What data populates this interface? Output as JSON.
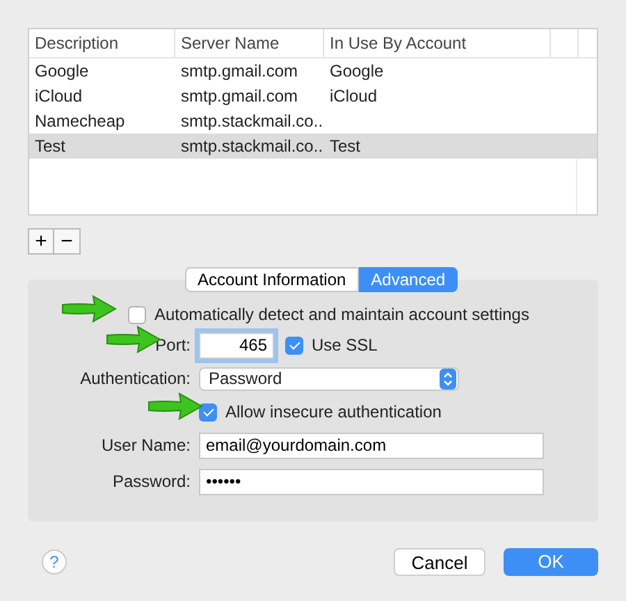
{
  "table": {
    "columns": [
      "Description",
      "Server Name",
      "In Use By Account"
    ],
    "rows": [
      {
        "cells": [
          "Google",
          "smtp.gmail.com",
          "Google"
        ],
        "selected": false
      },
      {
        "cells": [
          "iCloud",
          "smtp.gmail.com",
          "iCloud"
        ],
        "selected": false
      },
      {
        "cells": [
          "Namecheap",
          "smtp.stackmail.co..",
          ""
        ],
        "selected": false
      },
      {
        "cells": [
          "Test",
          "smtp.stackmail.co..",
          "Test"
        ],
        "selected": true
      }
    ]
  },
  "list_controls": {
    "add": "+",
    "remove": "−"
  },
  "tabs": [
    {
      "label": "Account Information",
      "selected": false
    },
    {
      "label": "Advanced",
      "selected": true
    }
  ],
  "settings": {
    "auto_detect": {
      "label": "Automatically detect and maintain account settings",
      "checked": false
    },
    "port": {
      "label": "Port:",
      "value": "465",
      "focused": true
    },
    "use_ssl": {
      "label": "Use SSL",
      "checked": true
    },
    "authentication": {
      "label": "Authentication:",
      "value": "Password"
    },
    "allow_insecure": {
      "label": "Allow insecure authentication",
      "checked": true
    },
    "user_name": {
      "label": "User Name:",
      "value": "email@yourdomain.com"
    },
    "password": {
      "label": "Password:",
      "value": "••••••"
    }
  },
  "buttons": {
    "help": "?",
    "cancel": "Cancel",
    "ok": "OK"
  }
}
